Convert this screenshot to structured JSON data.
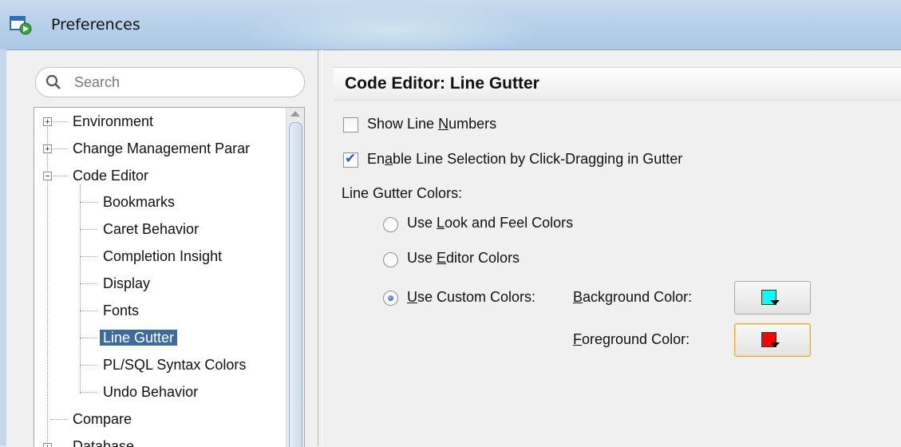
{
  "window": {
    "title": "Preferences"
  },
  "search": {
    "placeholder": "Search"
  },
  "tree": {
    "environment": "Environment",
    "change_management": "Change Management Parar",
    "code_editor": "Code Editor",
    "children": {
      "bookmarks": "Bookmarks",
      "caret_behavior": "Caret Behavior",
      "completion_insight": "Completion Insight",
      "display": "Display",
      "fonts": "Fonts",
      "line_gutter": "Line Gutter",
      "plsql_syntax_colors": "PL/SQL Syntax Colors",
      "undo_behavior": "Undo Behavior"
    },
    "compare": "Compare",
    "database": "Database",
    "selected": "Line Gutter"
  },
  "panel": {
    "title": "Code Editor: Line Gutter",
    "show_line_numbers": {
      "label_pre": "Show Line ",
      "label_mnemonic": "N",
      "label_post": "umbers",
      "checked": false
    },
    "enable_line_selection": {
      "label_pre": "En",
      "label_mnemonic": "a",
      "label_post": "ble Line Selection by Click-Dragging in Gutter",
      "checked": true
    },
    "colors_heading": "Line Gutter Colors:",
    "radio_look_feel": {
      "label_pre": "Use ",
      "label_mnemonic": "L",
      "label_post": "ook and Feel Colors",
      "selected": false
    },
    "radio_editor": {
      "label_pre": "Use ",
      "label_mnemonic": "E",
      "label_post": "ditor Colors",
      "selected": false
    },
    "radio_custom": {
      "label_mnemonic": "U",
      "label_post": "se Custom Colors:",
      "selected": true
    },
    "background_color": {
      "label_mnemonic": "B",
      "label_post": "ackground Color:",
      "value": "#00ffff"
    },
    "foreground_color": {
      "label_mnemonic": "F",
      "label_post": "oreground Color:",
      "value": "#ff0000"
    }
  },
  "colors": {
    "selection": "#3d6b9e",
    "checkmark": "#2a5fa8",
    "focus_border": "#e3a73b"
  }
}
